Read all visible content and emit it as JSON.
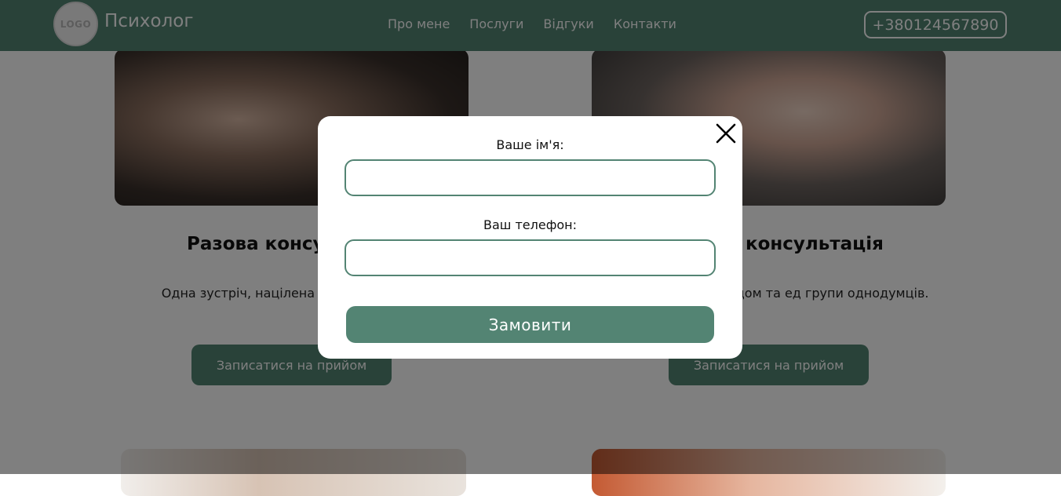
{
  "header": {
    "logo_text": "LOGO",
    "brand": "Психолог",
    "nav": [
      "Про мене",
      "Послуги",
      "Відгуки",
      "Контакти"
    ],
    "phone": "+380124567890"
  },
  "cards": [
    {
      "title": "Разова консу",
      "text": "Одна зустріч, націлена конкретної про",
      "button": "Записатися на прийом"
    },
    {
      "title": "консультація",
      "text": "вість обміну досвідом та ед групи однодумців.",
      "button": "Записатися на прийом"
    }
  ],
  "modal": {
    "name_label": "Ваше ім'я:",
    "name_value": "",
    "phone_label": "Ваш телефон:",
    "phone_value": "",
    "submit": "Замовити",
    "close_icon": "close-icon"
  },
  "colors": {
    "accent": "#538473",
    "overlay": "rgba(0,0,0,0.5)"
  }
}
